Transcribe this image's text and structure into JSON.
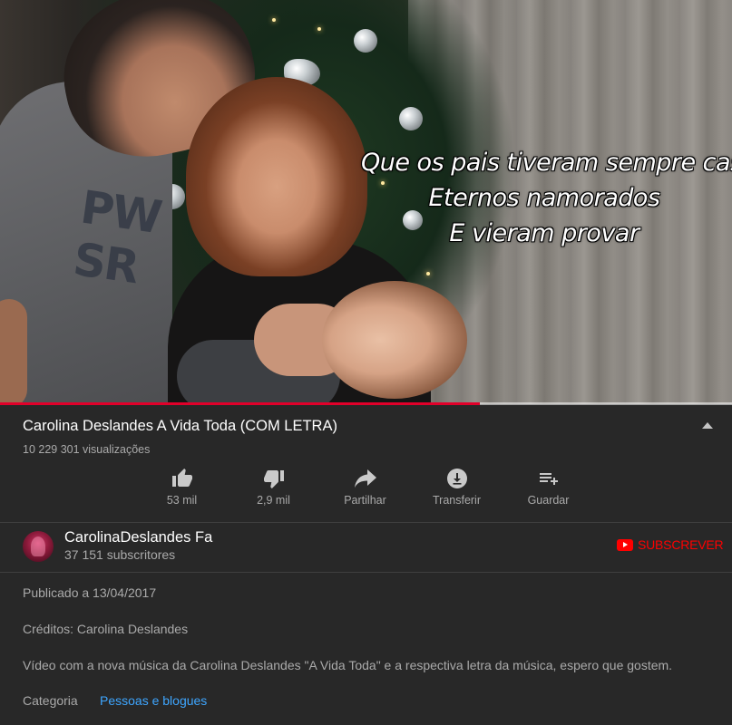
{
  "video": {
    "lyrics": [
      "Que os pais tiveram sempre casados",
      "Eternos namorados",
      "E vieram provar"
    ],
    "shirt_print": "PW\nSR",
    "progress": 0.655,
    "progress_color": "#e1002a"
  },
  "info": {
    "title": "Carolina Deslandes A Vida Toda (COM LETRA)",
    "views": "10 229 301 visualizações",
    "collapse_icon": "chevron-up-icon"
  },
  "actions": [
    {
      "label": "53 mil",
      "icon": "thumbs-up-icon"
    },
    {
      "label": "2,9 mil",
      "icon": "thumbs-down-icon"
    },
    {
      "label": "Partilhar",
      "icon": "share-icon"
    },
    {
      "label": "Transferir",
      "icon": "download-icon"
    },
    {
      "label": "Guardar",
      "icon": "playlist-add-icon"
    }
  ],
  "channel": {
    "name": "CarolinaDeslandes Fa",
    "subscribers": "37 151 subscritores",
    "subscribe_label": "SUBSCREVER",
    "subscribe_color": "#ff0000"
  },
  "description": {
    "published": "Publicado a 13/04/2017",
    "credits": "Créditos: Carolina Deslandes",
    "text": "Vídeo com a nova música da Carolina Deslandes \"A Vida Toda\" e a respectiva letra da música, espero que gostem.",
    "category_label": "Categoria",
    "category_value": "Pessoas e blogues",
    "link_color": "#3ea6ff"
  }
}
